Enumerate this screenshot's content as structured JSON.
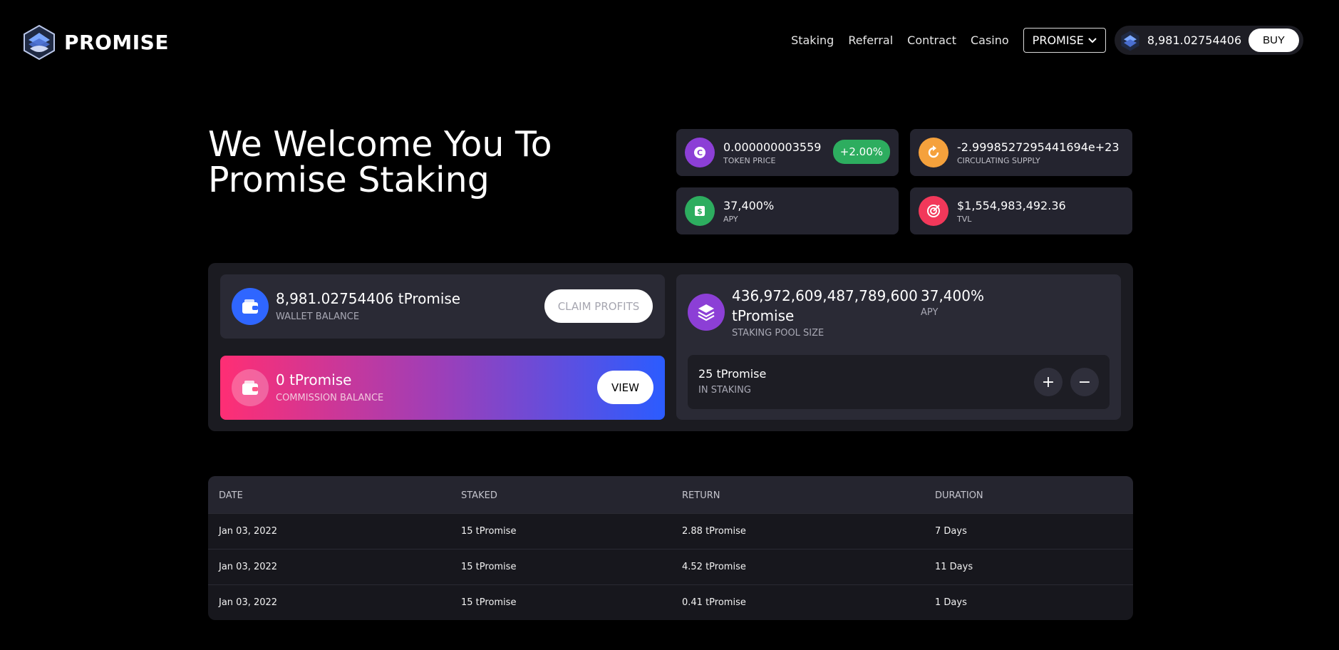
{
  "brand": {
    "name": "PROMISE"
  },
  "nav": {
    "items": [
      "Staking",
      "Referral",
      "Contract",
      "Casino"
    ],
    "token_select": "PROMISE",
    "wallet_amount": "8,981.02754406",
    "buy_label": "BUY"
  },
  "hero": {
    "title": "We Welcome You To Promise Staking"
  },
  "stats": {
    "token_price": {
      "value": "0.000000003559",
      "label": "TOKEN PRICE",
      "change": "+2.00%"
    },
    "circulating_supply": {
      "value": "-2.9998527295441694e+23",
      "label": "CIRCULATING SUPPLY"
    },
    "apy": {
      "value": "37,400%",
      "label": "APY"
    },
    "tvl": {
      "value": "$1,554,983,492.36",
      "label": "TVL"
    }
  },
  "wallet_card": {
    "value": "8,981.02754406 tPromise",
    "label": "WALLET BALANCE",
    "button": "CLAIM PROFITS"
  },
  "commission_card": {
    "value": "0 tPromise",
    "label": "COMMISSION BALANCE",
    "button": "VIEW"
  },
  "pool_card": {
    "value_line1": "436,972,609,487,789,600",
    "value_line2": "tPromise",
    "label": "STAKING POOL SIZE",
    "apy_value": "37,400%",
    "apy_label": "APY",
    "staking_value": "25 tPromise",
    "staking_label": "IN STAKING",
    "plus": "+",
    "minus": "−"
  },
  "table": {
    "headers": [
      "DATE",
      "STAKED",
      "RETURN",
      "DURATION"
    ],
    "rows": [
      [
        "Jan 03, 2022",
        "15 tPromise",
        "2.88 tPromise",
        "7 Days"
      ],
      [
        "Jan 03, 2022",
        "15 tPromise",
        "4.52 tPromise",
        "11 Days"
      ],
      [
        "Jan 03, 2022",
        "15 tPromise",
        "0.41 tPromise",
        "1 Days"
      ]
    ]
  },
  "colors": {
    "background": "#000000",
    "card": "#24242f",
    "purple": "#8c3fd6",
    "orange": "#f5a13c",
    "green": "#2dad5f",
    "pink": "#f2385a",
    "blue": "#2f66ff"
  },
  "icons": {
    "token_price": "coin-icon",
    "circulating_supply": "refresh-icon",
    "apy": "money-icon",
    "tvl": "target-icon",
    "wallet": "wallet-icon",
    "pool": "layers-icon"
  }
}
